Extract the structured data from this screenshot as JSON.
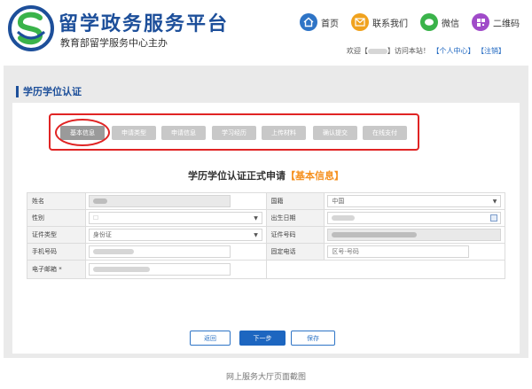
{
  "site": {
    "title": "留学政务服务平台",
    "subtitle": "教育部留学服务中心主办"
  },
  "topnav": [
    {
      "label": "首页",
      "icon": "home-icon"
    },
    {
      "label": "联系我们",
      "icon": "mail-icon"
    },
    {
      "label": "微信",
      "icon": "wechat-icon"
    },
    {
      "label": "二维码",
      "icon": "qrcode-icon"
    }
  ],
  "welcome": {
    "greeting": "欢迎【",
    "name_hidden": "",
    "tail": "】访问本站！",
    "user_center": "【个人中心】",
    "logout": "【注销】"
  },
  "section": {
    "title": "学历学位认证"
  },
  "steps": [
    {
      "label": "基本信息",
      "active": true
    },
    {
      "label": "申请类型",
      "active": false
    },
    {
      "label": "申请信息",
      "active": false
    },
    {
      "label": "学习经历",
      "active": false
    },
    {
      "label": "上传材料",
      "active": false
    },
    {
      "label": "确认提交",
      "active": false
    },
    {
      "label": "在线支付",
      "active": false
    }
  ],
  "form_title": {
    "main": "学历学位认证正式申请",
    "highlight": "【基本信息】"
  },
  "form": {
    "name_label": "姓名",
    "nationality_label": "国籍",
    "nationality_value": "中国",
    "gender_label": "性别",
    "gender_value": "☐",
    "birth_label": "出生日期",
    "id_type_label": "证件类型",
    "id_type_value": "身份证",
    "id_no_label": "证件号码",
    "mobile_label": "手机号码",
    "phone_label": "固定电话",
    "phone_placeholder": "区号-号码",
    "email_label": "电子邮箱 *"
  },
  "buttons": {
    "back": "返回",
    "next": "下一步",
    "save": "保存"
  },
  "caption": "网上服务大厅页面截图",
  "colors": {
    "brand": "#1d4f9a",
    "accent": "#f5901e",
    "highlight_border": "#e02424",
    "primary_button": "#1d66c0"
  }
}
